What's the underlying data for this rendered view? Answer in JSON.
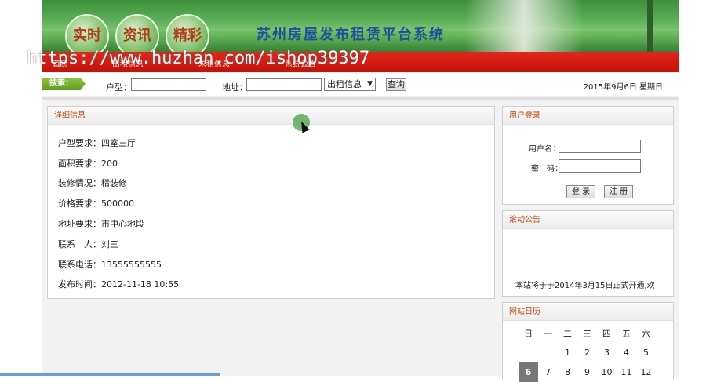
{
  "watermark": "https://www.huzhan.com/ishop39397",
  "header": {
    "circles": [
      "实时",
      "资讯",
      "精彩"
    ],
    "site_title": "苏州房屋发布租赁平台系统",
    "nav_items": [
      "首页",
      "出租信息",
      "求租信息",
      "系统公告"
    ]
  },
  "search": {
    "tag_label": "搜索：",
    "room_label": "户型：",
    "room_value": "",
    "address_label": "地址：",
    "address_value": "",
    "type_selected": "出租信息",
    "query_button": "查询",
    "date_text": "2015年9月6日 星期日"
  },
  "detail": {
    "title": "详细信息",
    "rows": [
      "户型要求：四室三厅",
      "面积要求：200",
      "装修情况：精装修",
      "价格要求：500000",
      "地址要求：市中心地段",
      "联系　人：刘三",
      "联系电话：13555555555",
      "发布时间：2012-11-18 10:55"
    ]
  },
  "login": {
    "title": "用户登录",
    "username_label": "用户名：",
    "password_label": "密　码：",
    "login_button": "登 录",
    "register_button": "注 册"
  },
  "notice": {
    "title": "滚动公告",
    "text": "本站将于于2014年3月15日正式开通,欢"
  },
  "calendar": {
    "title": "网站日历",
    "weekdays": [
      "日",
      "一",
      "二",
      "三",
      "四",
      "五",
      "六"
    ],
    "row1": [
      "",
      "",
      "1",
      "2",
      "3",
      "4",
      "5"
    ],
    "row2": [
      "6",
      "7",
      "8",
      "9",
      "10",
      "11",
      "12"
    ],
    "today": "6"
  },
  "colors": {
    "nav_red": "#d81c12",
    "search_green": "#6aa82a",
    "panel_title": "#c04a10"
  }
}
